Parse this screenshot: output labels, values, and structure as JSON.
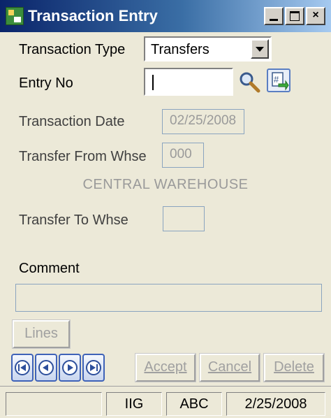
{
  "window": {
    "title": "Transaction Entry",
    "minimize": "minimize",
    "maximize": "maximize",
    "close_label": "×"
  },
  "form": {
    "transaction_type_label": "Transaction Type",
    "transaction_type_value": "Transfers",
    "entry_no_label": "Entry No",
    "entry_no_value": "",
    "transaction_date_label": "Transaction Date",
    "transaction_date_value": "02/25/2008",
    "transfer_from_label": "Transfer From Whse",
    "transfer_from_value": "000",
    "transfer_from_name": "CENTRAL WAREHOUSE",
    "transfer_to_label": "Transfer To Whse",
    "transfer_to_value": "",
    "comment_label": "Comment",
    "comment_value": ""
  },
  "buttons": {
    "lines": "Lines",
    "accept": "Accept",
    "cancel": "Cancel",
    "delete": "Delete",
    "nav": [
      "first",
      "previous",
      "next",
      "last"
    ]
  },
  "statusbar": {
    "cell1": "",
    "company": "IIG",
    "user": "ABC",
    "date": "2/25/2008"
  },
  "icons": {
    "app": "app-icon",
    "search": "magnifier-icon",
    "lookup": "lookup-icon"
  },
  "colors": {
    "titlebar_start": "#0a246a",
    "titlebar_end": "#a6caf0",
    "background": "#ece9d8",
    "nav_border": "#3e62b8"
  }
}
